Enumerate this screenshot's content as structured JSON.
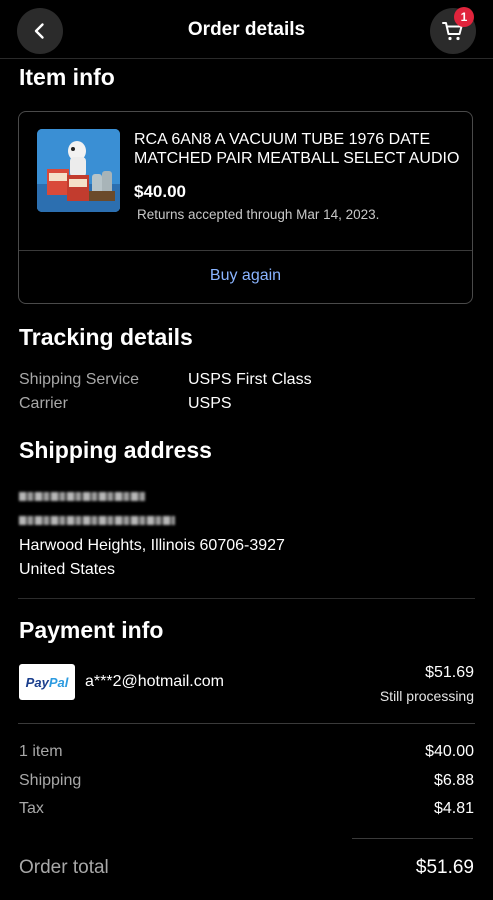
{
  "header": {
    "title": "Order details",
    "back_icon": "chevron-left-icon",
    "cart_icon": "cart-icon",
    "cart_badge": "1",
    "badge_color": "#e0243c"
  },
  "item_info": {
    "title": "Item info",
    "item": {
      "name": "RCA 6AN8 A VACUUM TUBE 1976 DATE MATCHED PAIR MEATBALL SELECT AUDIO",
      "price": "$40.00",
      "returns": "Returns accepted through Mar 14, 2023."
    },
    "buy_again": "Buy again",
    "link_color": "#8ab4ff"
  },
  "tracking": {
    "title": "Tracking details",
    "rows": [
      {
        "label": "Shipping Service",
        "value": "USPS First Class"
      },
      {
        "label": "Carrier",
        "value": "USPS"
      }
    ]
  },
  "shipping_address": {
    "title": "Shipping address",
    "lines": [
      "Harwood Heights, Illinois 60706-3927",
      "United States"
    ]
  },
  "payment": {
    "title": "Payment info",
    "method_logo": {
      "part1": "Pay",
      "part2": "Pal"
    },
    "email": "a***2@hotmail.com",
    "amount": "$51.69",
    "status": "Still processing"
  },
  "summary": {
    "rows": [
      {
        "label": "1 item",
        "value": "$40.00"
      },
      {
        "label": "Shipping",
        "value": "$6.88"
      },
      {
        "label": "Tax",
        "value": "$4.81"
      }
    ],
    "total_label": "Order total",
    "total_value": "$51.69"
  }
}
